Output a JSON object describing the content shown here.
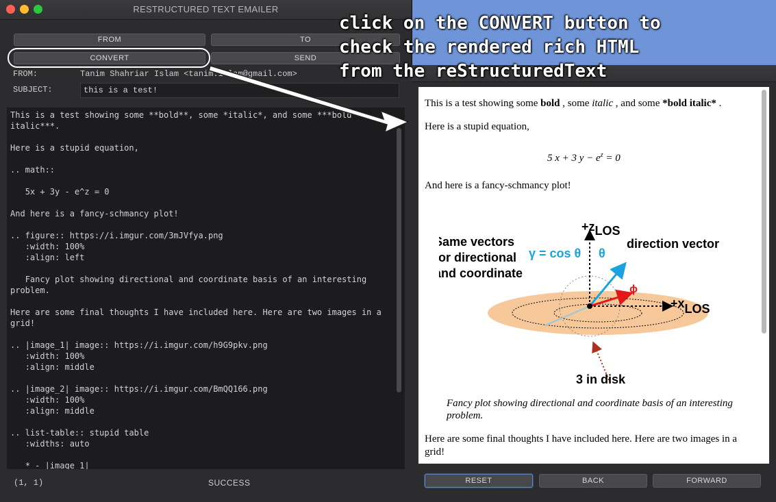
{
  "left_window": {
    "title": "RESTRUCTURED TEXT EMAILER",
    "buttons": {
      "from": "FROM",
      "to": "TO",
      "convert": "CONVERT",
      "send": "SEND"
    },
    "from_label": "FROM:",
    "from_value": "Tanim Shahriar Islam <tanim.islam@gmail.com>",
    "subject_label": "SUBJECT:",
    "subject_value": "this is a test!",
    "editor_text": "This is a test showing some **bold**, some *italic*, and some ***bold\nitalic***.\n\nHere is a stupid equation,\n\n.. math::\n\n   5x + 3y - e^z = 0\n\nAnd here is a fancy-schmancy plot!\n\n.. figure:: https://i.imgur.com/3mJVfya.png\n   :width: 100%\n   :align: left\n\n   Fancy plot showing directional and coordinate basis of an interesting\nproblem.\n\nHere are some final thoughts I have included here. Here are two images in a\ngrid!\n\n.. |image_1| image:: https://i.imgur.com/h9G9pkv.png\n   :width: 100%\n   :align: middle\n\n.. |image_2| image:: https://i.imgur.com/BmQQ166.png\n   :width: 100%\n   :align: middle\n\n.. list-table:: stupid table\n   :widths: auto\n\n   * - |image_1|",
    "status_position": "(1, 1)",
    "status_message": "SUCCESS"
  },
  "right_window": {
    "para1": {
      "a": "This is a test showing some ",
      "bold": "bold",
      "b": " , some ",
      "italic": "italic",
      "c": " , and some ",
      "bold_italic": "*bold italic*",
      "d": " ."
    },
    "para2": "Here is a stupid equation,",
    "equation": {
      "a": "5 x + 3 y − e",
      "sup": "z",
      "b": " = 0"
    },
    "para3": "And here is a fancy-schmancy plot!",
    "figure": {
      "axis_z": "+z",
      "axis_z_sub": "LOS",
      "axis_x": "+x",
      "axis_x_sub": "LOS",
      "left_text": [
        "Same vectors",
        "for directional",
        "and coordinate"
      ],
      "gamma": "γ = cos θ",
      "theta": "θ",
      "direction": "direction vector",
      "phi": "ϕ",
      "disk": "3 in disk",
      "colors": {
        "disk": "#f7c99a",
        "direction": "#1aa3dc",
        "phi": "#e01818",
        "gamma": "#1aa3dc"
      }
    },
    "caption": "Fancy plot showing directional and coordinate basis of an interesting problem.",
    "para4": "Here are some final thoughts I have included here. Here are two images in a grid!",
    "buttons": {
      "reset": "RESET",
      "back": "BACK",
      "forward": "FORWARD"
    }
  },
  "annotation": {
    "text": "click on the CONVERT button to\ncheck the rendered rich HTML\nfrom the reStructuredText"
  }
}
